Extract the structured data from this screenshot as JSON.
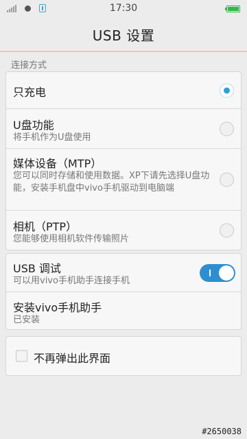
{
  "status_bar": {
    "time": "17:30"
  },
  "header": {
    "title": "USB 设置"
  },
  "connection": {
    "section_label": "连接方式",
    "options": [
      {
        "title": "只充电",
        "subtitle": "",
        "selected": true
      },
      {
        "title": "U盘功能",
        "subtitle": "将手机作为U盘使用",
        "selected": false
      },
      {
        "title": "媒体设备（MTP）",
        "subtitle": "您可以同时存储和使用数据。XP下请先选择U盘功能，安装手机盘中vivo手机驱动到电脑端",
        "selected": false
      },
      {
        "title": "相机（PTP）",
        "subtitle": "您能够使用相机软件传输照片",
        "selected": false
      }
    ]
  },
  "debug": {
    "usb_debug": {
      "title": "USB 调试",
      "subtitle": "可以用vivo手机助手连接手机",
      "enabled": true
    },
    "assistant": {
      "title": "安装vivo手机助手",
      "subtitle": "已安装"
    }
  },
  "dont_show": {
    "label": "不再弹出此界面",
    "checked": false
  },
  "watermark": "#2650038",
  "colors": {
    "accent": "#2da0d8",
    "toggle_on": "#2e8fd0",
    "header_divider": "#f3c79a",
    "battery": "#2db84b"
  }
}
